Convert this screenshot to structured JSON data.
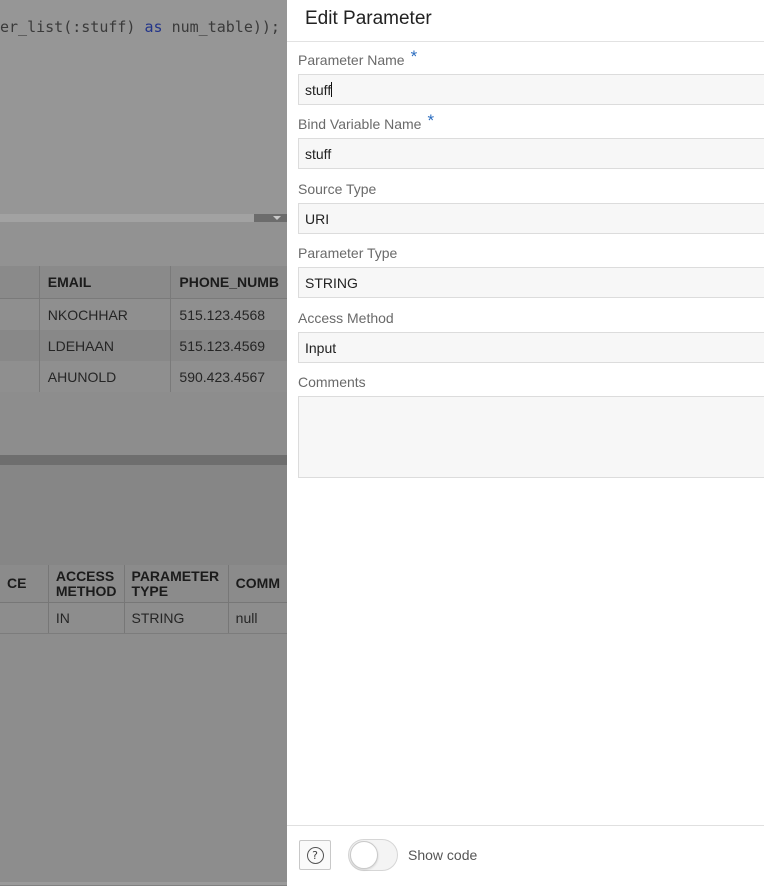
{
  "background": {
    "code": {
      "prefix": "er_list(:stuff) ",
      "keyword": "as",
      "suffix": " num_table));"
    },
    "results_grid": {
      "columns": [
        "EMAIL",
        "PHONE_NUMB"
      ],
      "rows": [
        [
          "NKOCHHAR",
          "515.123.4568"
        ],
        [
          "LDEHAAN",
          "515.123.4569"
        ],
        [
          "AHUNOLD",
          "590.423.4567"
        ]
      ]
    },
    "params_grid": {
      "columns": [
        "CE",
        "ACCESS METHOD",
        "PARAMETER TYPE",
        "COMM"
      ],
      "rows": [
        [
          "",
          "IN",
          "STRING",
          "null"
        ]
      ]
    }
  },
  "panel": {
    "title": "Edit Parameter",
    "required_marker": "*",
    "fields": {
      "parameter_name": {
        "label": "Parameter Name",
        "value": "stuff"
      },
      "bind_variable_name": {
        "label": "Bind Variable Name",
        "value": "stuff"
      },
      "source_type": {
        "label": "Source Type",
        "value": "URI"
      },
      "parameter_type": {
        "label": "Parameter Type",
        "value": "STRING"
      },
      "access_method": {
        "label": "Access Method",
        "value": "Input"
      },
      "comments": {
        "label": "Comments",
        "value": ""
      }
    },
    "footer": {
      "help_icon": "?",
      "show_code_label": "Show code",
      "show_code_on": false
    }
  },
  "colors": {
    "overlay": "#808080",
    "required_accent": "#2a6cbf",
    "keyword": "#23358a"
  }
}
